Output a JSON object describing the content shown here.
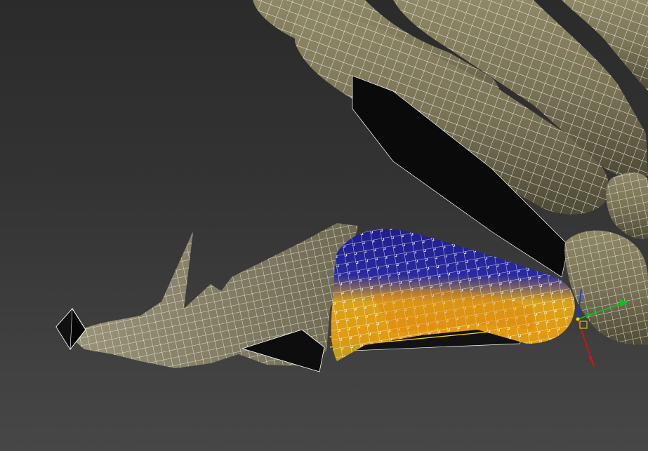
{
  "viewport": {
    "background_top": "#2b2b2b",
    "background_bottom": "#474747",
    "wire_color": "#ffffff",
    "bone_color": "#7a7456",
    "selection_hot": "#e39a10",
    "selection_cold": "#1e1e8c"
  },
  "gizmo": {
    "x_axis_color": "#e01010",
    "y_axis_color": "#10c020",
    "z_axis_color": "#1030ff"
  },
  "icons": [
    "transform-gizmo-icon"
  ]
}
